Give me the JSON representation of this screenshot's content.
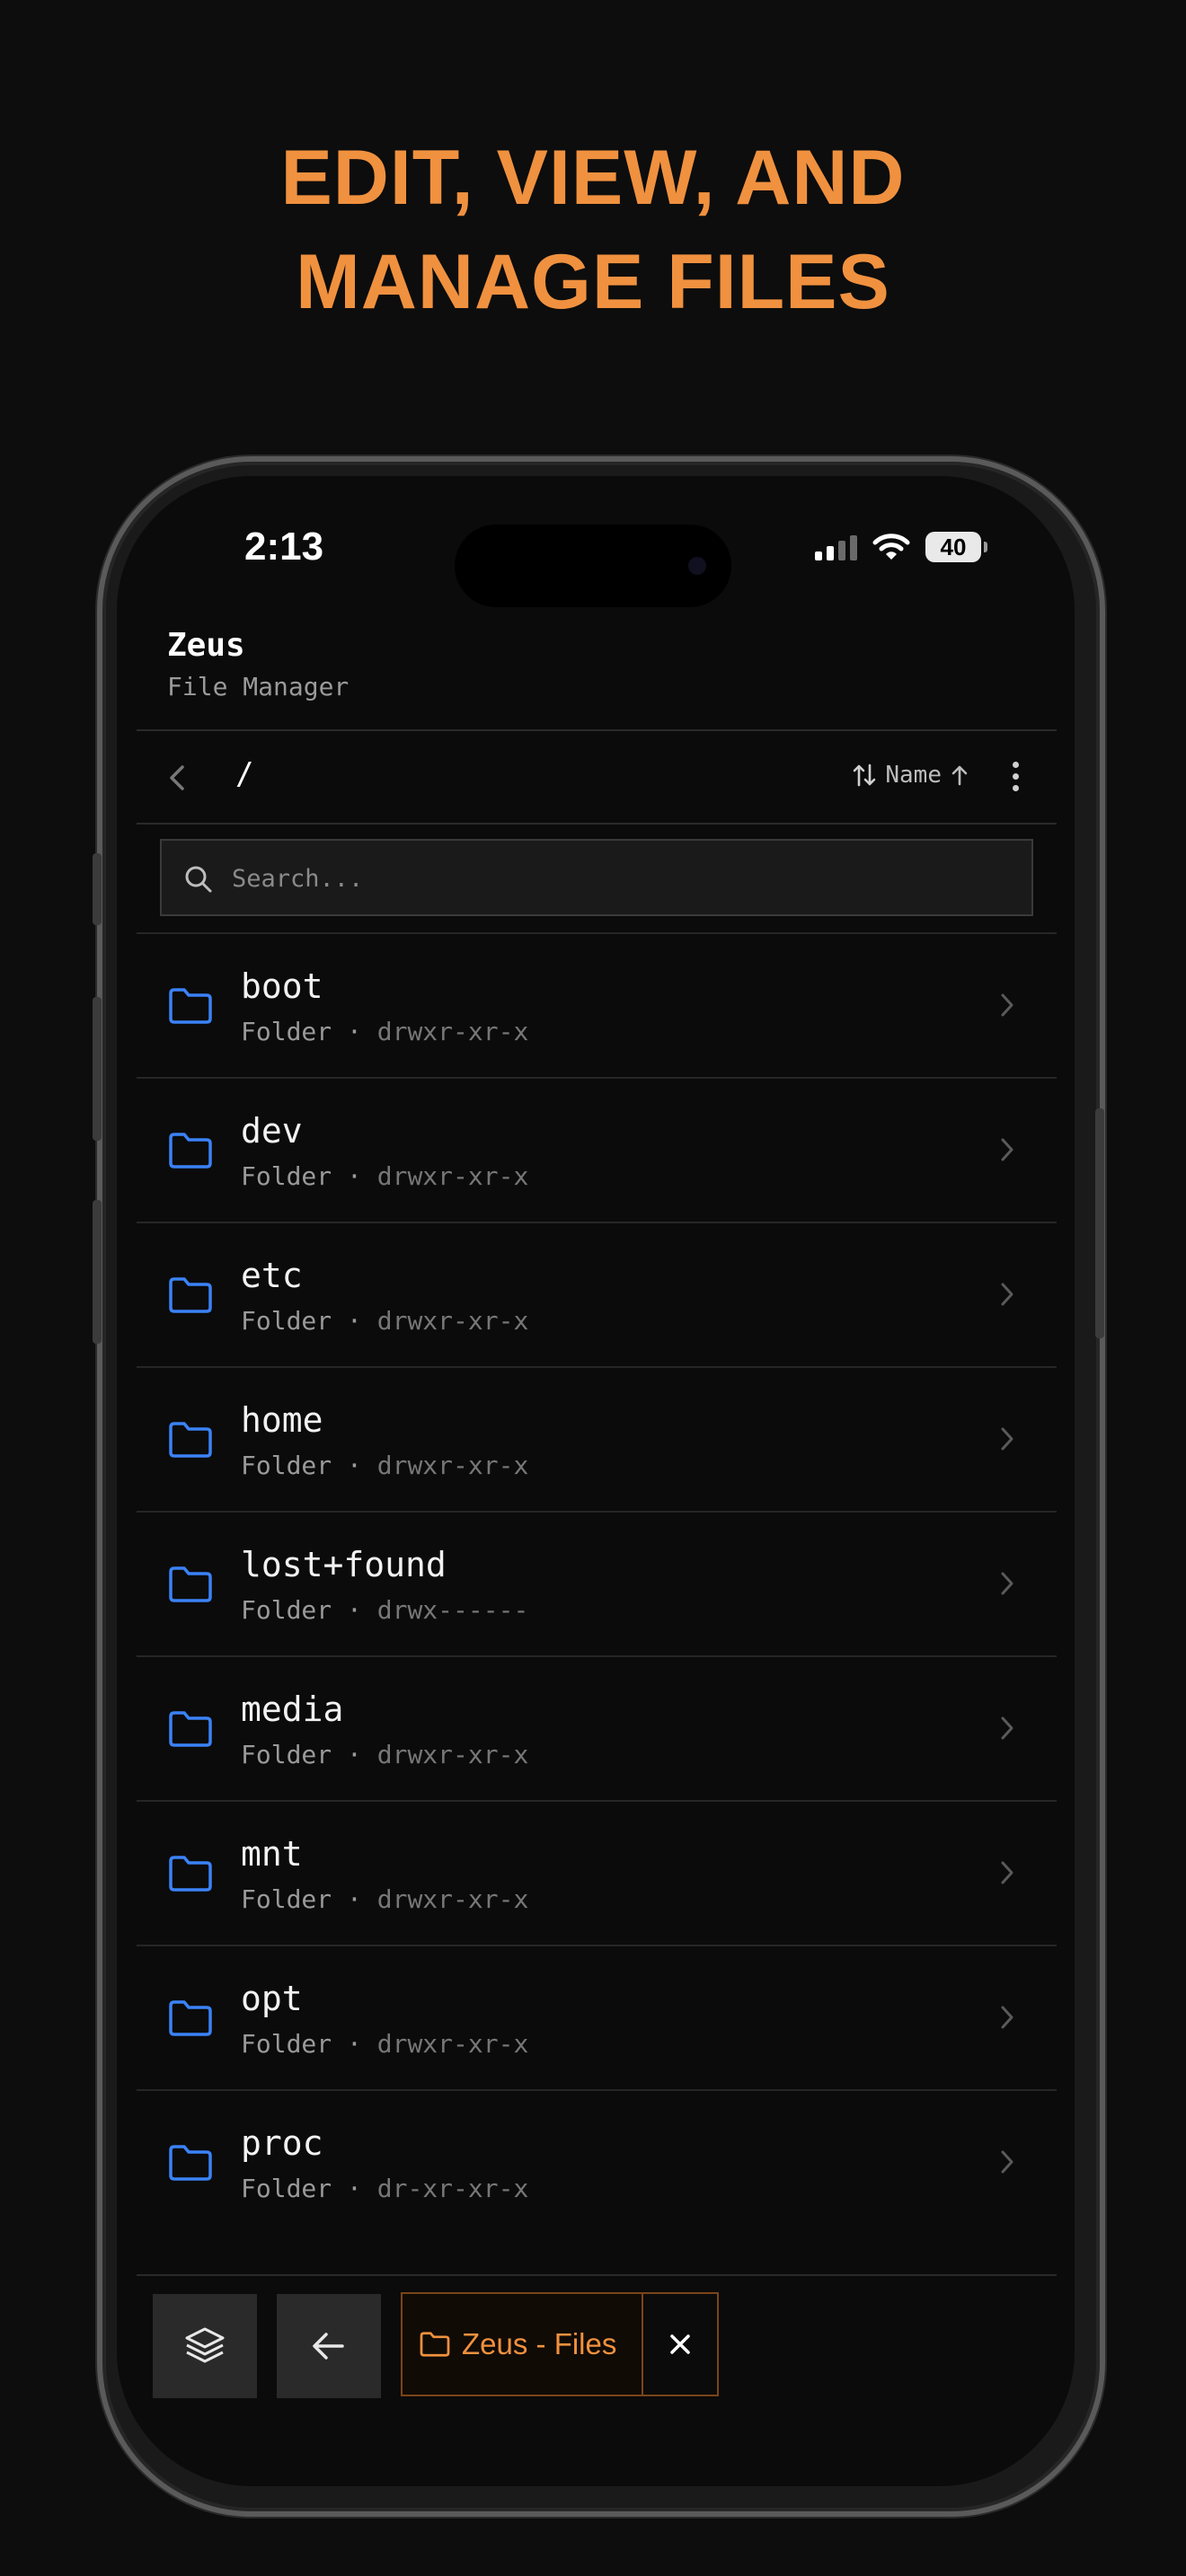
{
  "headline": {
    "line1": "EDIT, VIEW, AND",
    "line2": "MANAGE FILES"
  },
  "status_bar": {
    "time": "2:13",
    "battery": "40"
  },
  "app": {
    "title": "Zeus",
    "subtitle": "File Manager"
  },
  "nav": {
    "path": "/",
    "sort_label": "Name",
    "sort_direction": "ascending"
  },
  "search": {
    "placeholder": "Search...",
    "value": ""
  },
  "files": [
    {
      "name": "boot",
      "type": "Folder",
      "permissions": "drwxr-xr-x"
    },
    {
      "name": "dev",
      "type": "Folder",
      "permissions": "drwxr-xr-x"
    },
    {
      "name": "etc",
      "type": "Folder",
      "permissions": "drwxr-xr-x"
    },
    {
      "name": "home",
      "type": "Folder",
      "permissions": "drwxr-xr-x"
    },
    {
      "name": "lost+found",
      "type": "Folder",
      "permissions": "drwx------"
    },
    {
      "name": "media",
      "type": "Folder",
      "permissions": "drwxr-xr-x"
    },
    {
      "name": "mnt",
      "type": "Folder",
      "permissions": "drwxr-xr-x"
    },
    {
      "name": "opt",
      "type": "Folder",
      "permissions": "drwxr-xr-x"
    },
    {
      "name": "proc",
      "type": "Folder",
      "permissions": "dr-xr-xr-x"
    }
  ],
  "dock": {
    "tab_label": "Zeus - Files"
  },
  "icons": {
    "layers": "layers-icon",
    "back": "arrow-left-icon",
    "folder": "folder-icon",
    "close": "close-icon",
    "chevron": "chevron-right-icon",
    "search": "search-icon"
  },
  "colors": {
    "accent": "#f0913f",
    "folder": "#3b82f6",
    "background": "#0b0b0b"
  }
}
